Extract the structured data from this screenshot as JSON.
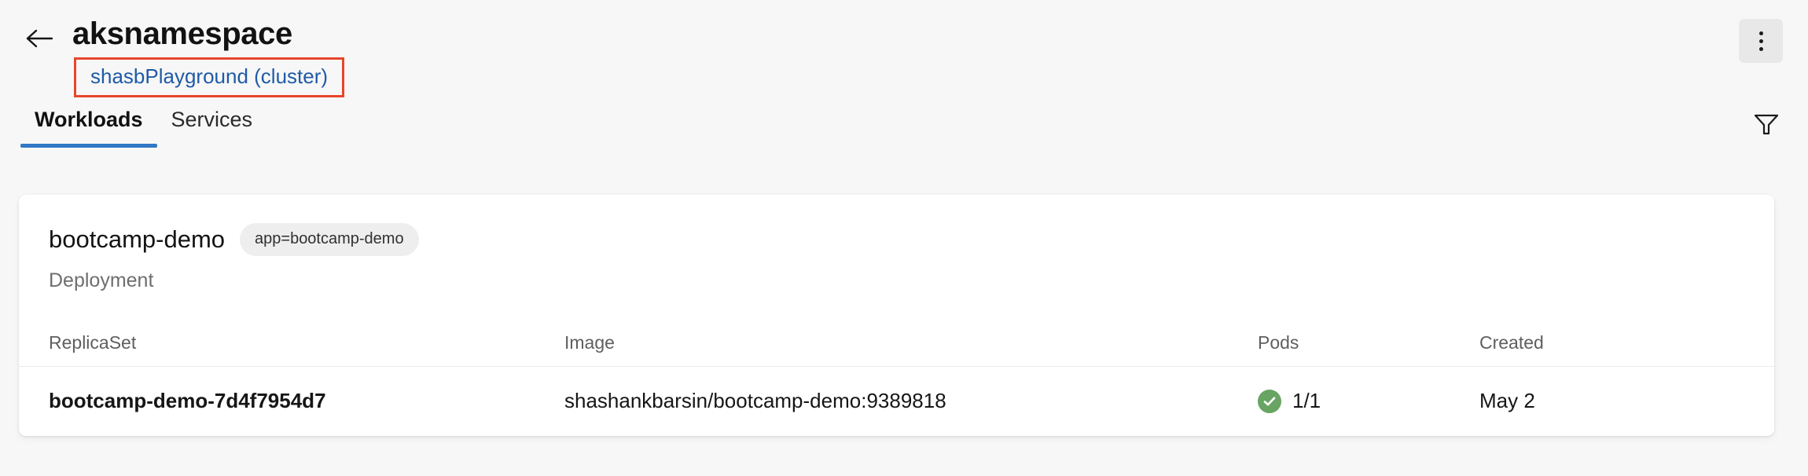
{
  "header": {
    "back_icon": "arrow-left-icon",
    "title": "aksnamespace",
    "cluster_link": "shasbPlayground (cluster)",
    "more_icon": "more-vertical-icon",
    "annotation_color": "#e8452a",
    "link_color": "#1f5ba6"
  },
  "tabs": {
    "items": [
      {
        "label": "Workloads",
        "active": true
      },
      {
        "label": "Services",
        "active": false
      }
    ],
    "filter_icon": "filter-funnel-icon",
    "indicator_color": "#3178c6"
  },
  "workload": {
    "name": "bootcamp-demo",
    "label_badge": "app=bootcamp-demo",
    "kind": "Deployment",
    "table": {
      "columns": [
        "ReplicaSet",
        "Image",
        "Pods",
        "Created"
      ],
      "rows": [
        {
          "replicaset": "bootcamp-demo-7d4f7954d7",
          "image": "shashankbarsin/bootcamp-demo:9389818",
          "pods": "1/1",
          "pods_status_icon": "check-circle-icon",
          "pods_status_color": "#68a463",
          "created": "May 2"
        }
      ]
    }
  }
}
